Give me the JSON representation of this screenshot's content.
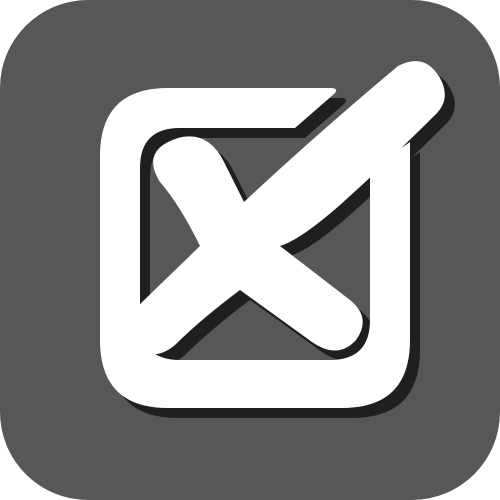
{
  "icon": {
    "name": "checkbox-x-icon",
    "background_color": "#575756",
    "foreground_color": "#ffffff",
    "shadow_color": "#1f1f1f"
  }
}
